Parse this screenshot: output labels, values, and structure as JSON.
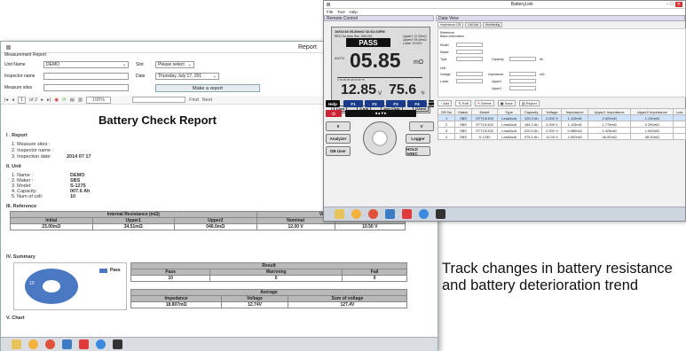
{
  "report_window": {
    "title": "Report",
    "subtitle": "Measurement Report",
    "form": {
      "unit_name_label": "Unit Name",
      "unit_name_value": "DEMO",
      "inspector_label": "Inspector name",
      "measure_label": "Measure sites",
      "slot_label": "Slot",
      "slot_value": "Please select",
      "date_label": "Date",
      "date_value": "Thursday    July    17, 201",
      "make_report_label": "Make a report"
    },
    "toolbar": {
      "page": "1",
      "of": "of 2",
      "zoom": "100%",
      "find": "Find",
      "next": "Next"
    },
    "doc": {
      "title": "Battery Check Report",
      "s1": "I . Report",
      "r1": "1. Measure sites :",
      "r2": "2. Inspector name :",
      "r3": "3. Inspection date:",
      "r3v": "2014 07 17",
      "s2": "II. Unit",
      "u_labels": [
        "1. Name :",
        "2. Maker :",
        "3. Model:",
        "4. Capacity:",
        "5. Num of cell:"
      ],
      "u_values": [
        "DEMO",
        "SBS",
        "S-1275",
        "007.6 Ah",
        "10"
      ],
      "s3": "III. Reference",
      "ref_group1": "Internal Resistance (mΩ)",
      "ref_group2": "Voltage (V)",
      "ref_headers": [
        "Initial",
        "Upper1",
        "Upper2",
        "Nominal",
        "Lower"
      ],
      "ref_values": [
        "23.00mΩ",
        "34.51mΩ",
        "046.0mΩ",
        "12.00 V",
        "10.50 V"
      ],
      "s4": "IV. Summary",
      "pie_legend": "Pass",
      "pie_label": "10",
      "result_title": "Result",
      "result_headers": [
        "Pass",
        "Warnning",
        "Fail"
      ],
      "result_values": [
        "10",
        "0",
        "0"
      ],
      "avg_title": "Average",
      "avg_headers": [
        "Impedance",
        "Voltage",
        "Sum of voltage"
      ],
      "avg_values": [
        "18.807mΩ",
        "12.74V",
        "127.4V"
      ],
      "s5": "V. Chart"
    },
    "colors": {
      "pie": "#4a78c2",
      "header_gray": "#b9b9b9"
    }
  },
  "batterylink": {
    "title": "BatteryLink",
    "menu": [
      "File",
      "Tool",
      "Help"
    ],
    "remote_control": "Remote Control",
    "data_view": "Data View",
    "tabs": [
      "Impedance DB",
      "List List",
      "Monitoring"
    ],
    "lcd": {
      "top": "16/01/18     05.85mΩ   02:52:23PM",
      "rec": "REC No:Auto  Sec :005-001",
      "upper1": "Upper1 12.00mΩ",
      "upper2": "Upper2 09.00mΩ",
      "lower": "Lower  10.00V",
      "pass": "PASS",
      "auto": "AUTO",
      "big": "05.85",
      "big_unit": "mΩ",
      "volt": "12.85",
      "volt_unit": "V",
      "temp": "75.6",
      "temp_unit": "°F",
      "scale": "0  15  25  35  45  55  65  75",
      "bottom": [
        "Lock",
        "0 Adj",
        "Avg Clear",
        "ΩAmd"
      ]
    },
    "keys": [
      "Help",
      "F1",
      "F2",
      "F3",
      "F4",
      "Record Display"
    ],
    "side_buttons": [
      "Analyzer",
      "DB User",
      "Logger",
      "HOLD AREC"
    ],
    "ref_form": {
      "reference": "Reference",
      "basic": "Basic Information",
      "model": "Model",
      "maker": "Maker",
      "type": "Type",
      "capacity": "Capacity",
      "unit": "Unit",
      "voltage": "Voltage",
      "impedance": "Impedance",
      "upper1": "Upper1",
      "upper2": "Upper2",
      "lower": "Lower",
      "ah": "Ah",
      "mohm": "mΩ"
    },
    "actions": [
      "Add",
      "Edit",
      "Delete",
      "Save",
      "Report"
    ],
    "table_headers": [
      "DB No",
      "Maker",
      "Model",
      "Type",
      "Capacity",
      "Voltage",
      "Impedance",
      "Upper1 Impedance",
      "Upper2 Impedance",
      "Low"
    ],
    "rows": [
      [
        "1",
        "SBS",
        "STT10/100",
        "LeadAcid",
        "120.0 Ah",
        "2.000 V",
        "1.115mΩ",
        "2.320mΩ",
        "1.130mΩ"
      ],
      [
        "2",
        "SBS",
        "STT10/100",
        "LeadAcid",
        "165.0 Ah",
        "2.000 V",
        "1.115mΩ",
        "1.776mΩ",
        "2.390mΩ"
      ],
      [
        "3",
        "SBS",
        "STT10/100",
        "LeadAcid",
        "220.0 Ah",
        "2.000 V",
        "0.985mΩ",
        "1.426mΩ",
        "1.900mΩ"
      ],
      [
        "4",
        "SBS",
        "S-1250",
        "LeadAcid",
        "075.0 Ah",
        "12.00 V",
        "4.000mΩ",
        "06.00mΩ",
        "08.00mΩ"
      ]
    ]
  },
  "tagline": "Track changes in battery resistance and battery deterioration trend"
}
